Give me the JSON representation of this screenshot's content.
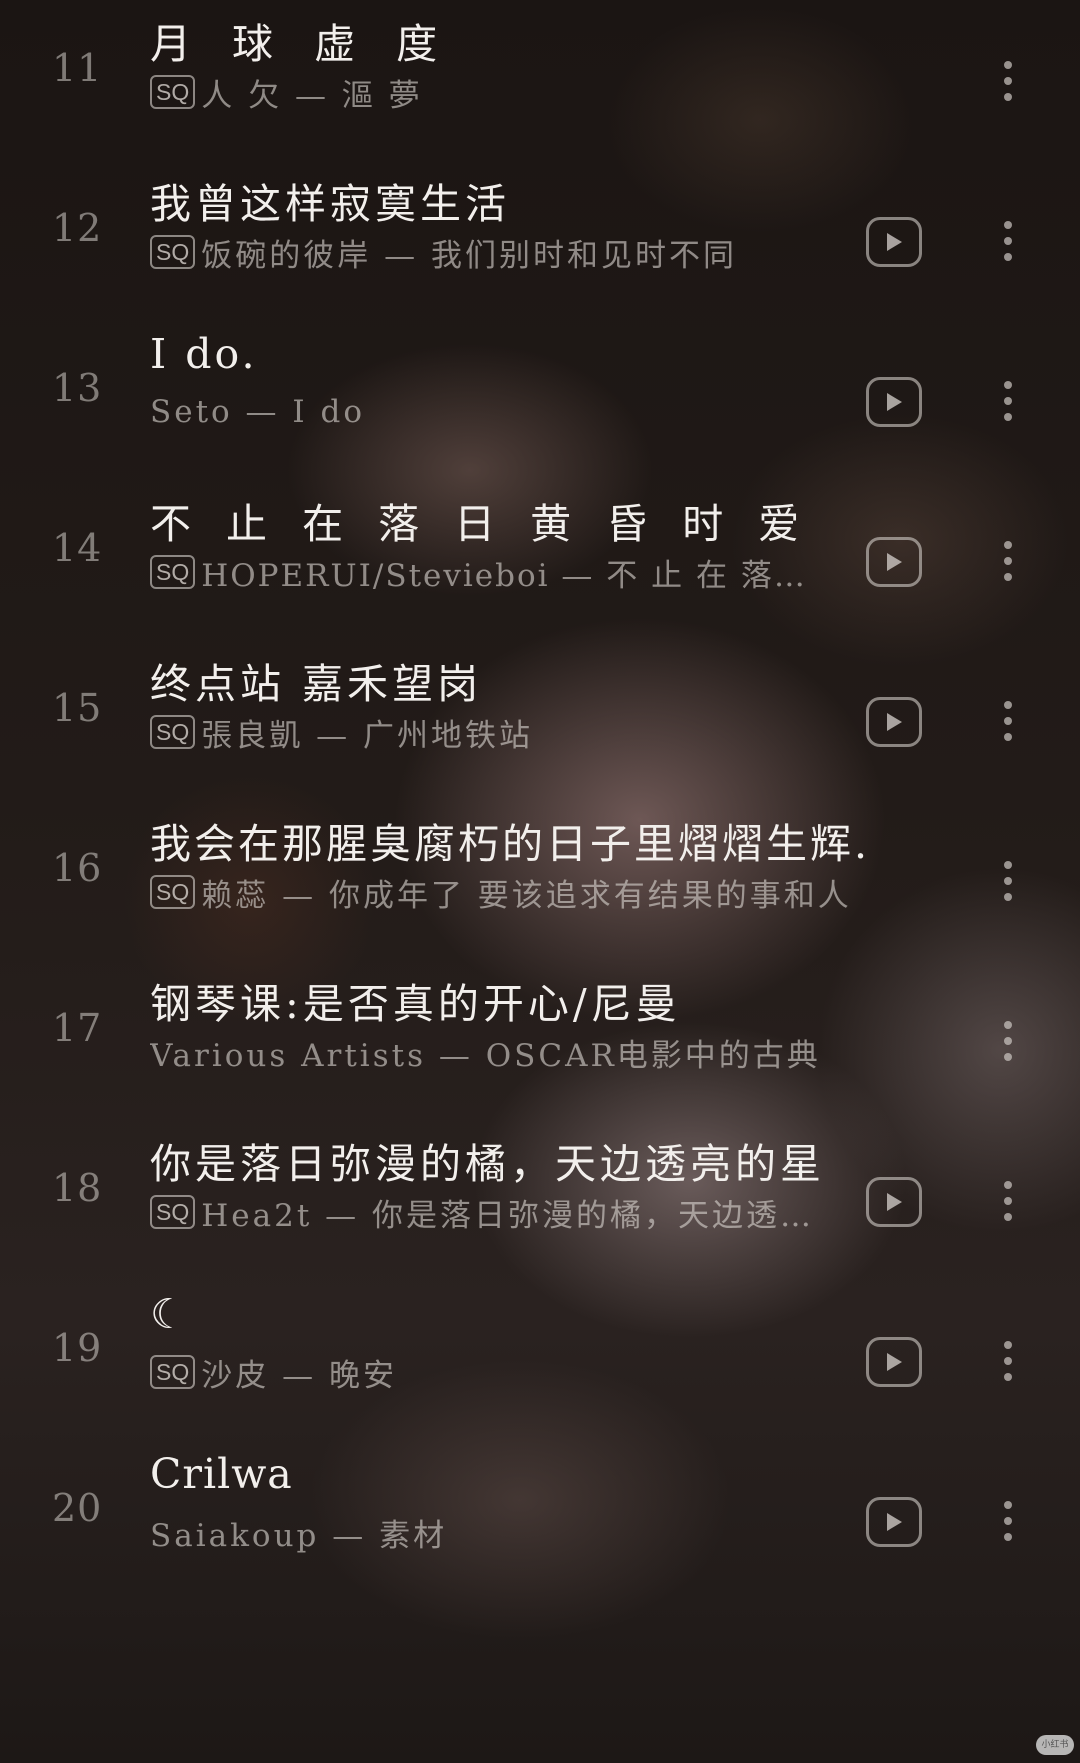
{
  "songs": [
    {
      "number": "11",
      "title": "月 球 虚 度",
      "quality": "SQ",
      "subtitle": "人 欠  —  漚 夢",
      "has_play": false
    },
    {
      "number": "12",
      "title": "我曾这样寂寞生活",
      "quality": "SQ",
      "subtitle": "饭碗的彼岸 — 我们别时和见时不同",
      "has_play": true
    },
    {
      "number": "13",
      "title": "I do.",
      "quality": "",
      "subtitle": "Seto — I do",
      "has_play": true
    },
    {
      "number": "14",
      "title": "不 止 在 落 日 黄 昏 时 爱 你",
      "quality": "SQ",
      "subtitle": "HOPERUI/Stevieboi — 不 止 在 落…",
      "has_play": true
    },
    {
      "number": "15",
      "title": "终点站 嘉禾望岗",
      "quality": "SQ",
      "subtitle": "張良凱 — 广州地铁站",
      "has_play": true
    },
    {
      "number": "16",
      "title": "我会在那腥臭腐朽的日子里熠熠生辉.",
      "quality": "SQ",
      "subtitle": "赖蕊 — 你成年了 要该追求有结果的事和人",
      "has_play": false
    },
    {
      "number": "17",
      "title": "钢琴课:是否真的开心/尼曼",
      "quality": "",
      "subtitle": "Various Artists — OSCAR电影中的古典",
      "has_play": false
    },
    {
      "number": "18",
      "title": "你是落日弥漫的橘，天边透亮的星",
      "quality": "SQ",
      "subtitle": "Hea2t — 你是落日弥漫的橘，天边透…",
      "has_play": true
    },
    {
      "number": "19",
      "title": "☾",
      "quality": "SQ",
      "subtitle": "沙皮 — 晚安",
      "has_play": true
    },
    {
      "number": "20",
      "title": "Crilwa",
      "quality": "",
      "subtitle": "Saiakoup — 素材",
      "has_play": true
    }
  ],
  "icons": {
    "play": "play-icon",
    "more": "more-vertical-icon"
  },
  "watermark": "小红书"
}
